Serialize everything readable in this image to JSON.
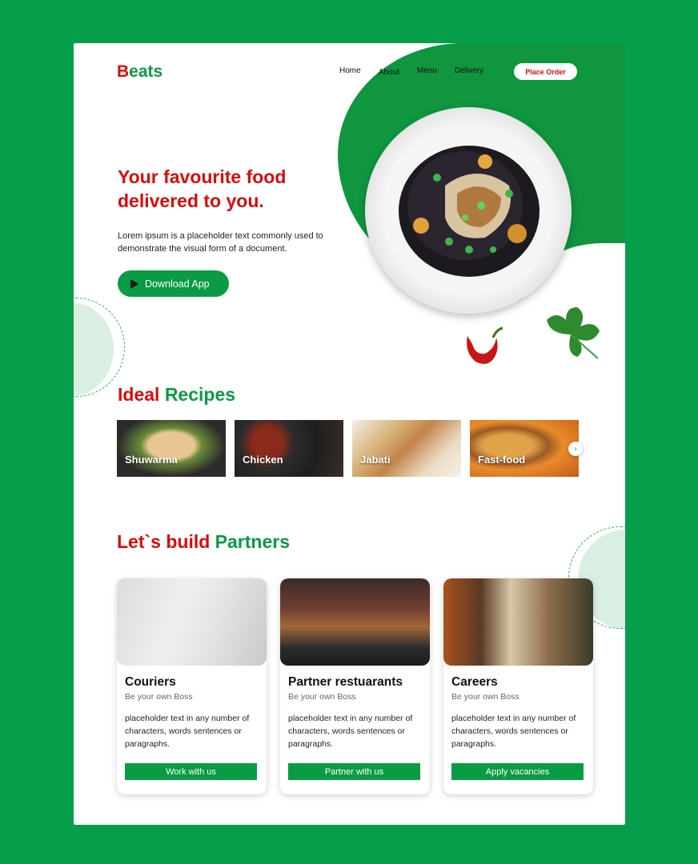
{
  "brand": {
    "letter": "B",
    "rest": "eats"
  },
  "nav": {
    "items": [
      "Home",
      "About",
      "Menu",
      "Delivery"
    ],
    "cta": "Place Order"
  },
  "hero": {
    "title": "Your favourite food delivered to you.",
    "text": "Lorem ipsum is a placeholder text commonly used to demonstrate the visual form of a document.",
    "download": "Download App",
    "download_icon": "play-store-icon"
  },
  "recipes": {
    "title_red": "Ideal",
    "title_green": "Recipes",
    "items": [
      "Shuwarma",
      "Chicken",
      "Jabati",
      "Fast-food"
    ],
    "next_icon": "chevron-right-icon"
  },
  "partners": {
    "title_red": "Let`s build",
    "title_green": "Partners",
    "cards": [
      {
        "title": "Couriers",
        "subtitle": "Be your own Boss",
        "text": "placeholder text in any number of characters, words sentences or paragraphs.",
        "button": "Work with us"
      },
      {
        "title": "Partner restuarants",
        "subtitle": "Be your own Boss",
        "text": "placeholder text in any number of characters, words sentences or paragraphs.",
        "button": "Partner with us"
      },
      {
        "title": "Careers",
        "subtitle": "Be your own Boss",
        "text": "placeholder text in any number of characters, words sentences or paragraphs.",
        "button": "Apply vacancies"
      }
    ]
  },
  "colors": {
    "brand_green": "#0a9b45",
    "brand_red": "#d90b0b",
    "background": "#079e4b"
  }
}
